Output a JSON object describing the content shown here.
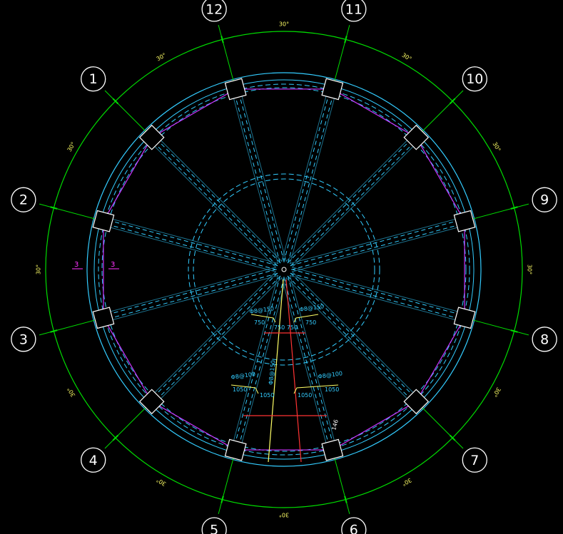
{
  "axes": [
    {
      "label": "12",
      "angle": 255
    },
    {
      "label": "11",
      "angle": 285
    },
    {
      "label": "10",
      "angle": 315
    },
    {
      "label": "9",
      "angle": 345
    },
    {
      "label": "8",
      "angle": 15
    },
    {
      "label": "7",
      "angle": 45
    },
    {
      "label": "6",
      "angle": 75
    },
    {
      "label": "5",
      "angle": 105
    },
    {
      "label": "4",
      "angle": 135
    },
    {
      "label": "3",
      "angle": 165
    },
    {
      "label": "2",
      "angle": 195
    },
    {
      "label": "1",
      "angle": 225
    }
  ],
  "angle_labels": [
    "30°",
    "30°",
    "30°",
    "30°",
    "30°",
    "30°",
    "30°",
    "30°",
    "30°",
    "30°",
    "30°",
    "30°"
  ],
  "section_marks": [
    "3",
    "3"
  ],
  "rebar_labels": {
    "inner_left": "Φ8@150",
    "inner_right": "Φ8@150",
    "inner_left_dim": "750",
    "inner_right_dim": "750",
    "inner_center": "750 750",
    "outer_left": "Φ8@100",
    "outer_right": "Φ8@100",
    "outer_left_dim1": "1050",
    "outer_left_dim2": "1050",
    "outer_right_dim1": "1050",
    "outer_right_dim2": "1050",
    "radial": "Φ8@150",
    "beam_tag": "146"
  },
  "colors": {
    "background": "#000000",
    "green": "#00dd00",
    "cyan": "#33ccff",
    "magenta": "#cc33ff",
    "white": "#ffffff",
    "yellow": "#ffff66",
    "red": "#ff3333"
  }
}
